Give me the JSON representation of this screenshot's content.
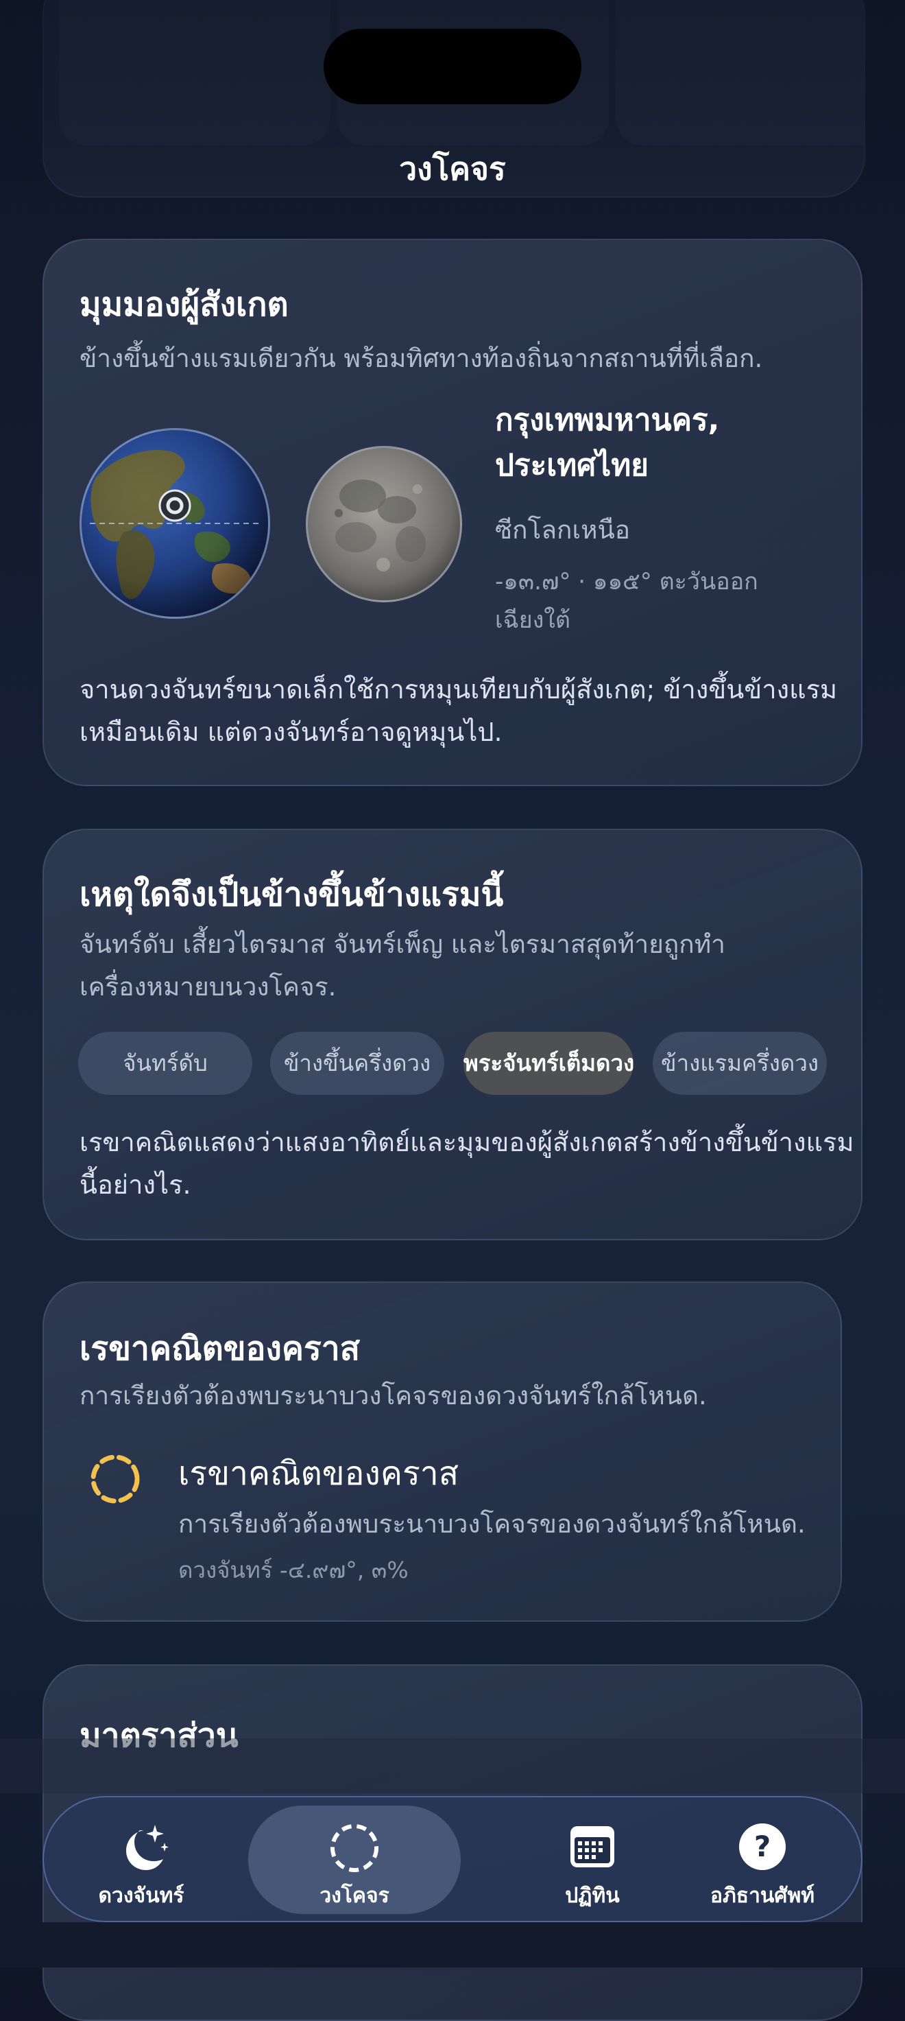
{
  "screen": {
    "title": "วงโคจร"
  },
  "observer_card": {
    "title": "มุมมองผู้สังเกต",
    "subtitle": "ข้างขึ้นข้างแรมเดียวกัน พร้อมทิศทางท้องถิ่นจากสถานที่ที่เลือก.",
    "location_line1": "กรุงเทพมหานคร,",
    "location_line2": "ประเทศไทย",
    "hemisphere": "ซีกโลกเหนือ",
    "coords_line1": "-๑๓.๗° · ๑๑๕° ตะวันออก",
    "coords_line2": "เฉียงใต้",
    "note_line1": "จานดวงจันทร์ขนาดเล็กใช้การหมุนเทียบกับผู้สังเกต; ข้างขึ้นข้างแรม",
    "note_line2": "เหมือนเดิม แต่ดวงจันทร์อาจดูหมุนไป."
  },
  "phase_card": {
    "title": "เหตุใดจึงเป็นข้างขึ้นข้างแรมนี้",
    "subtitle_line1": "จันทร์ดับ เสี้ยวไตรมาส จันทร์เพ็ญ และไตรมาสสุดท้ายถูกทำ",
    "subtitle_line2": "เครื่องหมายบนวงโคจร.",
    "chips": [
      {
        "label": "จันทร์ดับ",
        "active": false
      },
      {
        "label": "ข้างขึ้นครึ่งดวง",
        "active": false
      },
      {
        "label": "พระจันทร์เต็มดวง",
        "active": true
      },
      {
        "label": "ข้างแรมครึ่งดวง",
        "active": false
      }
    ],
    "note_line1": "เรขาคณิตแสดงว่าแสงอาทิตย์และมุมของผู้สังเกตสร้างข้างขึ้นข้างแรม",
    "note_line2": "นี้อย่างไร."
  },
  "eclipse_card": {
    "title": "เรขาคณิตของคราส",
    "subtitle": "การเรียงตัวต้องพบระนาบวงโคจรของดวงจันทร์ใกล้โหนด.",
    "row_title": "เรขาคณิตของคราส",
    "row_subtitle": "การเรียงตัวต้องพบระนาบวงโคจรของดวงจันทร์ใกล้โหนด.",
    "row_meta": "ดวงจันทร์ -๔.๙๗°, ๓%",
    "icon_color": "#f2c14e"
  },
  "scale_card": {
    "title": "มาตราส่วน"
  },
  "tabbar": {
    "tabs": [
      {
        "label": "ดวงจันทร์",
        "icon": "moon-stars-icon",
        "active": false
      },
      {
        "label": "วงโคจร",
        "icon": "orbit-icon",
        "active": true
      },
      {
        "label": "ปฏิทิน",
        "icon": "calendar-icon",
        "active": false
      },
      {
        "label": "อภิธานศัพท์",
        "icon": "question-icon",
        "active": false
      }
    ]
  }
}
